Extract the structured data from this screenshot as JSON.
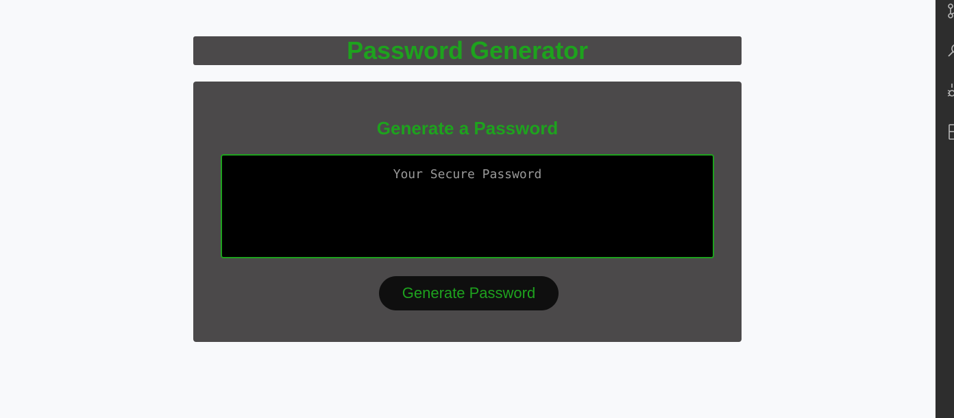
{
  "header": {
    "title": "Password Generator"
  },
  "card": {
    "heading": "Generate a Password",
    "password_value": "",
    "password_placeholder": "Your Secure Password",
    "generate_button_label": "Generate Password"
  },
  "right_rail": {
    "icons": [
      "source-control-icon",
      "search-icon",
      "debug-icon",
      "extensions-icon"
    ]
  },
  "colors": {
    "accent": "#1ea21e",
    "panel": "#4b494a",
    "page_background": "#f8f9fb",
    "textarea_background": "#000000",
    "button_background": "#0f0f0f",
    "rail_background": "#2d2d2d"
  }
}
